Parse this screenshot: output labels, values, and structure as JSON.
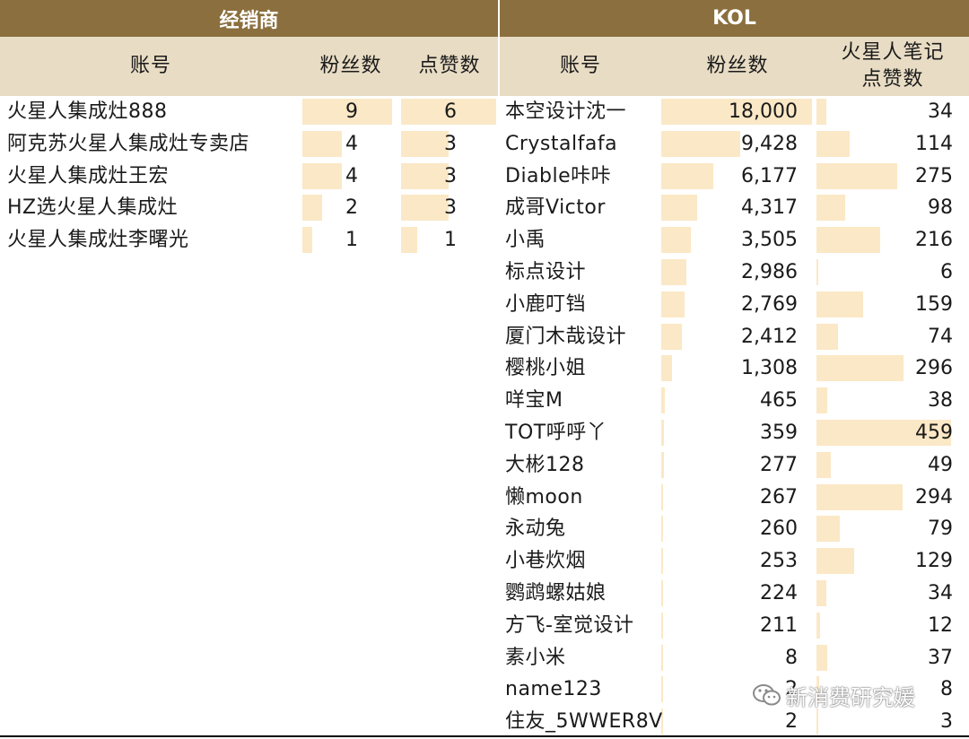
{
  "dealer": {
    "title": "经销商",
    "col_account": "账号",
    "col_fans": "粉丝数",
    "col_likes": "点赞数",
    "max_fans": 9,
    "max_likes": 6,
    "rows": [
      {
        "name": "火星人集成灶888",
        "fans": "9",
        "likes": "6"
      },
      {
        "name": "阿克苏火星人集成灶专卖店",
        "fans": "4",
        "likes": "3"
      },
      {
        "name": "火星人集成灶王宏",
        "fans": "4",
        "likes": "3"
      },
      {
        "name": "HZ选火星人集成灶",
        "fans": "2",
        "likes": "3"
      },
      {
        "name": "火星人集成灶李曙光",
        "fans": "1",
        "likes": "1"
      }
    ]
  },
  "kol": {
    "title": "KOL",
    "col_account": "账号",
    "col_fans": "粉丝数",
    "col_likes_line1": "火星人笔记",
    "col_likes_line2": "点赞数",
    "max_fans": 18000,
    "max_likes": 459,
    "rows": [
      {
        "name": "本空设计沈一",
        "fans": "18,000",
        "likes": "34"
      },
      {
        "name": "Crystalfafa",
        "fans": "9,428",
        "likes": "114"
      },
      {
        "name": "Diable咔咔",
        "fans": "6,177",
        "likes": "275"
      },
      {
        "name": "成哥Victor",
        "fans": "4,317",
        "likes": "98"
      },
      {
        "name": "小禹",
        "fans": "3,505",
        "likes": "216"
      },
      {
        "name": "标点设计",
        "fans": "2,986",
        "likes": "6"
      },
      {
        "name": "小鹿叮铛",
        "fans": "2,769",
        "likes": "159"
      },
      {
        "name": "厦门木哉设计",
        "fans": "2,412",
        "likes": "74"
      },
      {
        "name": "樱桃小姐",
        "fans": "1,308",
        "likes": "296"
      },
      {
        "name": "咩宝M",
        "fans": "465",
        "likes": "38"
      },
      {
        "name": "TOT呼呼丫",
        "fans": "359",
        "likes": "459"
      },
      {
        "name": "大彬128",
        "fans": "277",
        "likes": "49"
      },
      {
        "name": "懒moon",
        "fans": "267",
        "likes": "294"
      },
      {
        "name": "永动兔",
        "fans": "260",
        "likes": "79"
      },
      {
        "name": "小巷炊烟",
        "fans": "253",
        "likes": "129"
      },
      {
        "name": "鹦鹉螺姑娘",
        "fans": "224",
        "likes": "34"
      },
      {
        "name": "方飞-室觉设计",
        "fans": "211",
        "likes": "12"
      },
      {
        "name": "素小米",
        "fans": "8",
        "likes": "37"
      },
      {
        "name": "name123",
        "fans": "2",
        "likes": "8"
      },
      {
        "name": "住友_5WWER8V",
        "fans": "2",
        "likes": "3"
      }
    ]
  },
  "watermark": "新消费研究媛",
  "colors": {
    "header_dark": "#8b6f3e",
    "header_light": "#e8dcc4",
    "bar_fill": "#fbe8c6"
  }
}
